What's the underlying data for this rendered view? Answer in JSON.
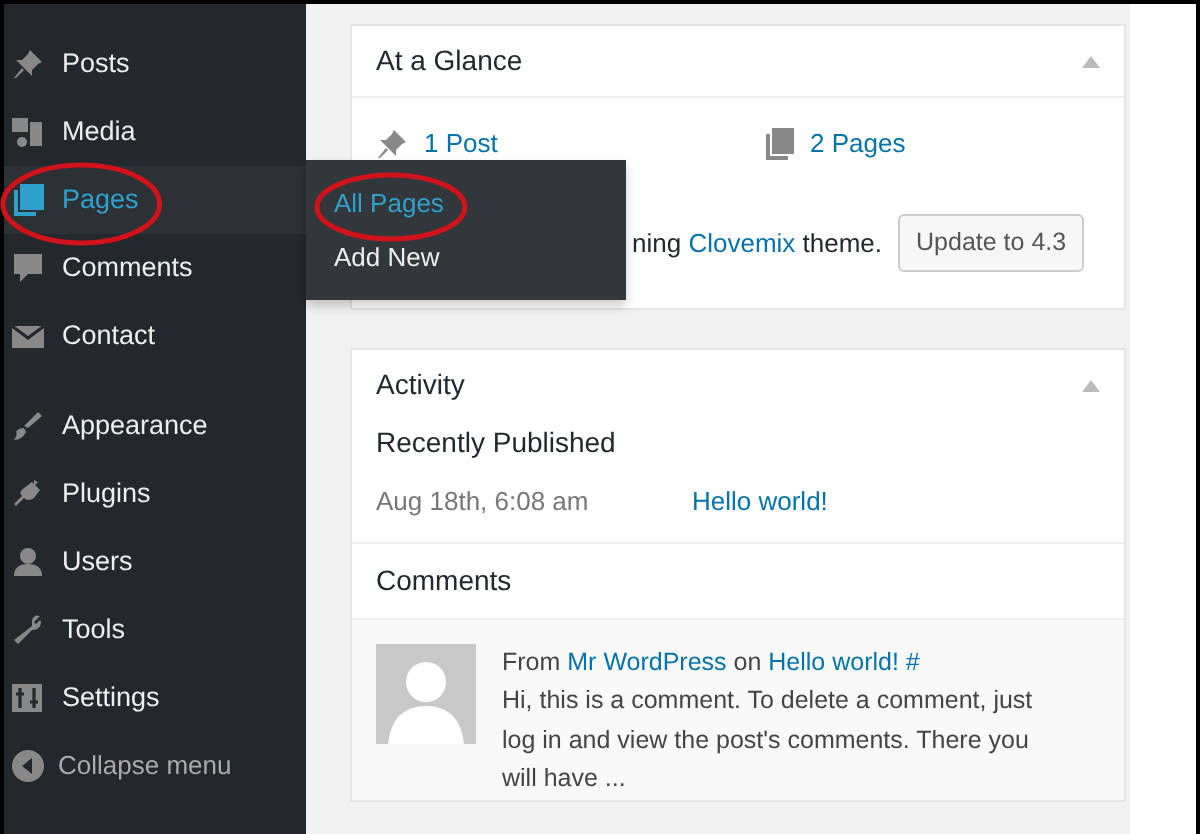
{
  "sidebar": {
    "items": [
      {
        "label": "Posts",
        "current": false,
        "highlighted": false
      },
      {
        "label": "Media",
        "current": false,
        "highlighted": false
      },
      {
        "label": "Pages",
        "current": true,
        "highlighted": true
      },
      {
        "label": "Comments",
        "current": false,
        "highlighted": false
      },
      {
        "label": "Contact",
        "current": false,
        "highlighted": false
      },
      {
        "label": "Appearance",
        "current": false,
        "highlighted": false,
        "separated": true
      },
      {
        "label": "Plugins",
        "current": false,
        "highlighted": false
      },
      {
        "label": "Users",
        "current": false,
        "highlighted": false
      },
      {
        "label": "Tools",
        "current": false,
        "highlighted": false
      },
      {
        "label": "Settings",
        "current": false,
        "highlighted": false
      }
    ],
    "collapse": "Collapse menu"
  },
  "flyout": {
    "items": [
      {
        "label": "All Pages",
        "selected": true,
        "highlighted": true
      },
      {
        "label": "Add New",
        "selected": false,
        "highlighted": false
      }
    ]
  },
  "at_a_glance": {
    "title": "At a Glance",
    "counts": [
      "1 Post",
      "2 Pages"
    ],
    "theme_text": [
      "ning ",
      "Clovemix",
      " theme."
    ],
    "update_button": "Update to 4.3"
  },
  "activity": {
    "title": "Activity",
    "recent_heading": "Recently Published",
    "recent": [
      {
        "date": "Aug 18th, 6:08 am",
        "title": "Hello world!"
      }
    ],
    "comments_heading": "Comments",
    "comment": {
      "from": "From",
      "author": "Mr WordPress",
      "on": "on",
      "post": "Hello world! #",
      "text": "Hi, this is a comment. To delete a comment, just log in and view the post's comments. There you will have ..."
    }
  }
}
